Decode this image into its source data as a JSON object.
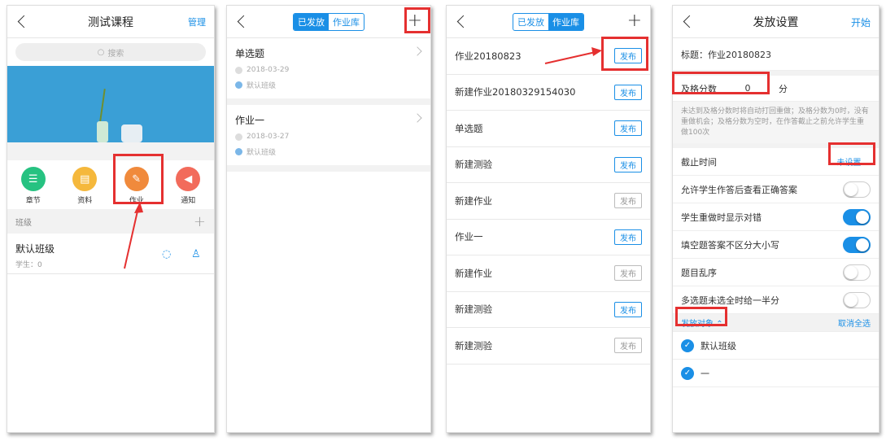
{
  "panel1": {
    "title": "测试课程",
    "manage": "管理",
    "search_placeholder": "搜索",
    "icons": [
      {
        "label": "章节",
        "icon": "list-icon",
        "color": "#26c281"
      },
      {
        "label": "资料",
        "icon": "document-icon",
        "color": "#f5b83c"
      },
      {
        "label": "作业",
        "icon": "homework-icon",
        "color": "#f08a3c"
      },
      {
        "label": "通知",
        "icon": "megaphone-icon",
        "color": "#f26b5b"
      }
    ],
    "section_label": "班级",
    "class_name": "默认班级",
    "class_students": "学生：0"
  },
  "panel2": {
    "tab_published": "已发放",
    "tab_library": "作业库",
    "items": [
      {
        "title": "单选题",
        "date": "2018-03-29",
        "class": "默认班级"
      },
      {
        "title": "作业一",
        "date": "2018-03-27",
        "class": "默认班级"
      }
    ]
  },
  "panel3": {
    "tab_published": "已发放",
    "tab_library": "作业库",
    "items": [
      {
        "title": "作业20180823",
        "btn": "发布",
        "enabled": true
      },
      {
        "title": "新建作业20180329154030",
        "btn": "发布",
        "enabled": true
      },
      {
        "title": "单选题",
        "btn": "发布",
        "enabled": true
      },
      {
        "title": "新建测验",
        "btn": "发布",
        "enabled": true
      },
      {
        "title": "新建作业",
        "btn": "发布",
        "enabled": false
      },
      {
        "title": "作业一",
        "btn": "发布",
        "enabled": true
      },
      {
        "title": "新建作业",
        "btn": "发布",
        "enabled": false
      },
      {
        "title": "新建测验",
        "btn": "发布",
        "enabled": true
      },
      {
        "title": "新建测验",
        "btn": "发布",
        "enabled": false
      }
    ]
  },
  "panel4": {
    "title": "发放设置",
    "start": "开始",
    "title_field": "标题：作业20180823",
    "pass_label": "及格分数",
    "pass_value": "0",
    "pass_unit": "分",
    "hint": "未达到及格分数时将自动打回重做；及格分数为0时，没有重做机会；及格分数为空时，在作答截止之前允许学生重做100次",
    "deadline_label": "截止时间",
    "deadline_value": "未设置",
    "toggles": [
      {
        "label": "允许学生作答后查看正确答案",
        "on": false
      },
      {
        "label": "学生重做时显示对错",
        "on": true
      },
      {
        "label": "填空题答案不区分大小写",
        "on": true
      },
      {
        "label": "题目乱序",
        "on": false
      },
      {
        "label": "多选题未选全时给一半分",
        "on": false
      }
    ],
    "target_label": "发放对象",
    "deselect_all": "取消全选",
    "targets": [
      "默认班级",
      "一"
    ]
  },
  "colors": {
    "accent": "#1a8fe6",
    "annotation_red": "#e53030"
  }
}
